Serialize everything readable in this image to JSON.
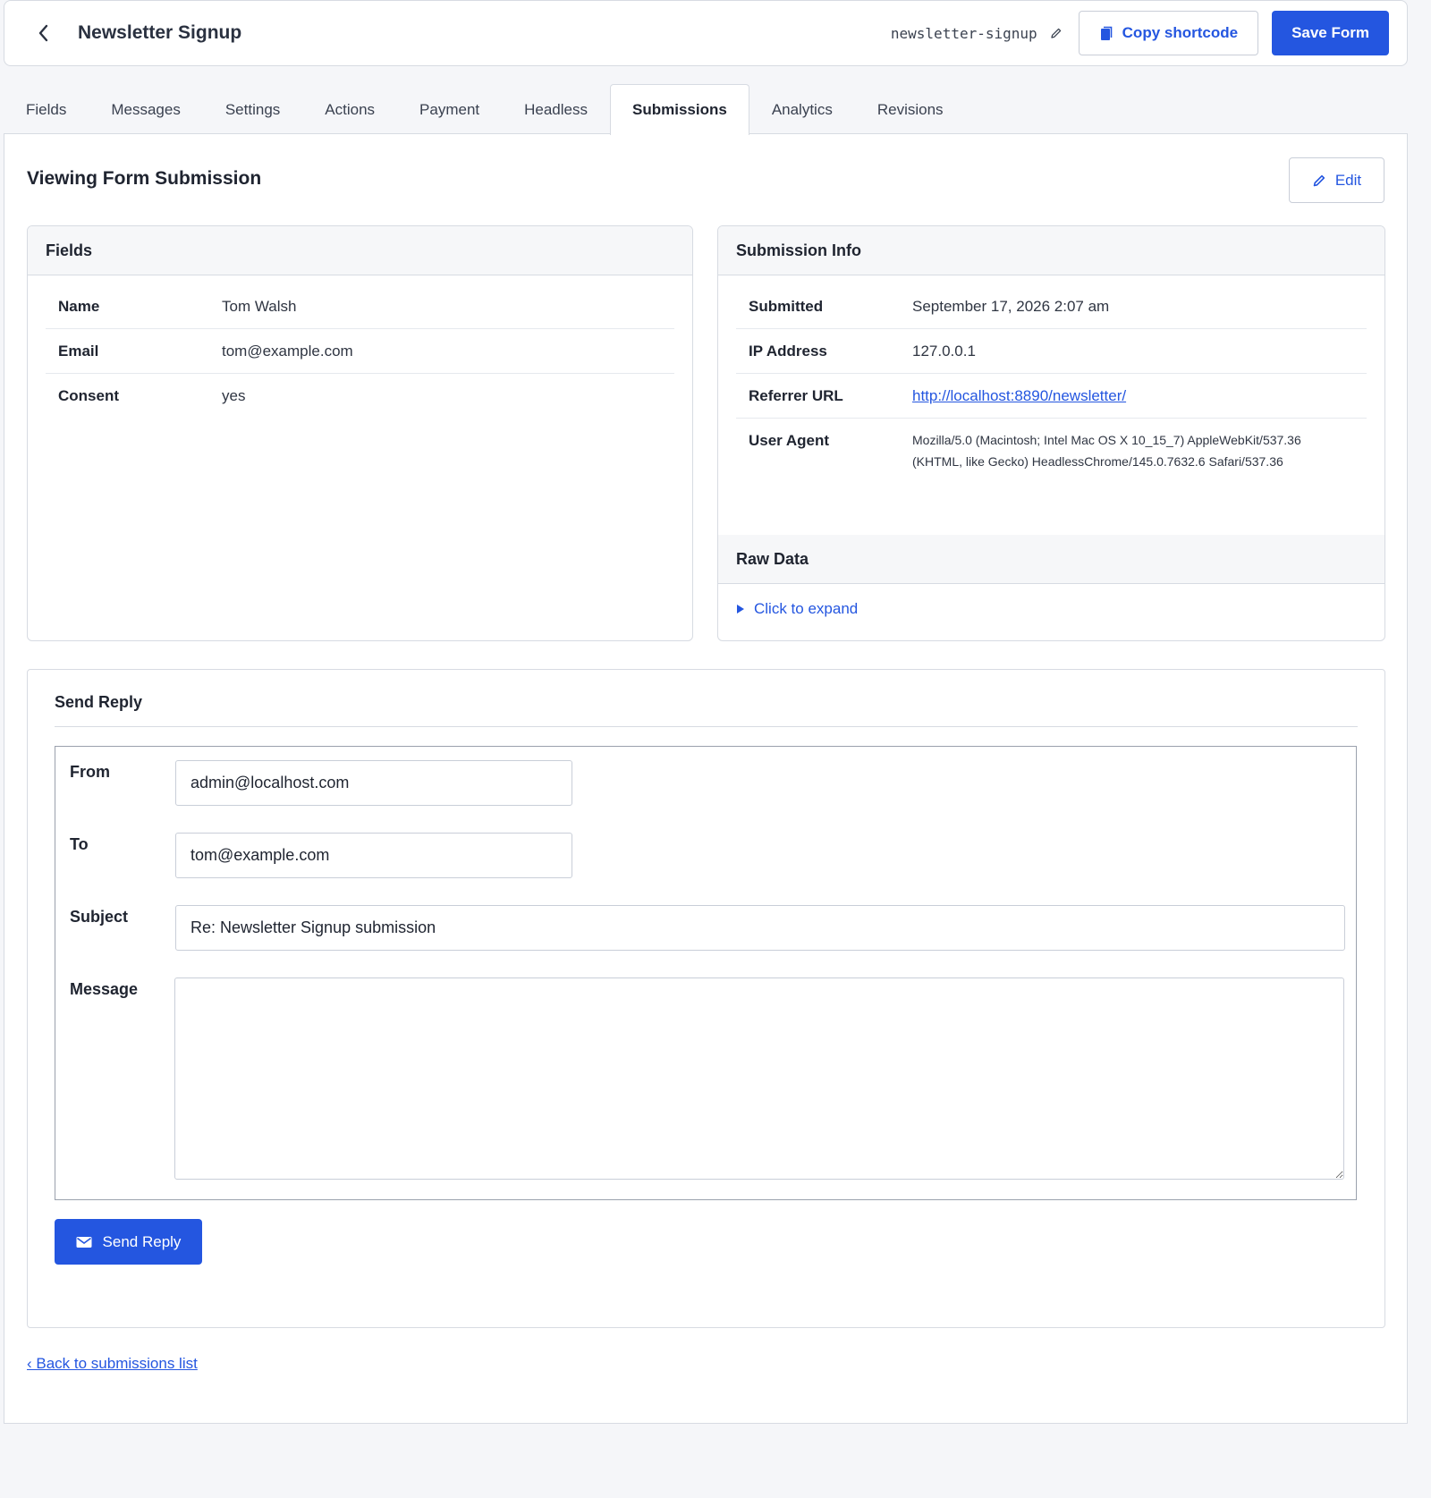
{
  "header": {
    "back_icon": "chevron-left-icon",
    "title": "Newsletter Signup",
    "slug": "newsletter-signup",
    "slug_edit_icon": "pencil-icon",
    "copy_shortcode_label": "Copy shortcode",
    "copy_icon": "clipboard-icon",
    "save_label": "Save Form"
  },
  "tabs": [
    {
      "label": "Fields"
    },
    {
      "label": "Messages"
    },
    {
      "label": "Settings"
    },
    {
      "label": "Actions"
    },
    {
      "label": "Payment"
    },
    {
      "label": "Headless"
    },
    {
      "label": "Submissions",
      "active": true
    },
    {
      "label": "Analytics"
    },
    {
      "label": "Revisions"
    }
  ],
  "page": {
    "title": "Viewing Form Submission",
    "edit_label": "Edit"
  },
  "fields_card": {
    "title": "Fields",
    "rows": [
      {
        "key": "Name",
        "value": "Tom Walsh"
      },
      {
        "key": "Email",
        "value": "tom@example.com"
      },
      {
        "key": "Consent",
        "value": "yes"
      }
    ]
  },
  "info_card": {
    "title": "Submission Info",
    "submitted_label": "Submitted",
    "submitted_value": "September 17, 2026 2:07 am",
    "ip_label": "IP Address",
    "ip_value": "127.0.0.1",
    "referrer_label": "Referrer URL",
    "referrer_value": "http://localhost:8890/newsletter/",
    "ua_label": "User Agent",
    "ua_line1": "Mozilla/5.0 (Macintosh; Intel Mac OS X 10_15_7) AppleWebKit/537.36",
    "ua_line2": "(KHTML, like Gecko) HeadlessChrome/145.0.7632.6 Safari/537.36",
    "raw_title": "Raw Data",
    "expand_label": "Click to expand"
  },
  "reply": {
    "title": "Send Reply",
    "from_label": "From",
    "from_value": "admin@localhost.com",
    "to_label": "To",
    "to_value": "tom@example.com",
    "subject_label": "Subject",
    "subject_value": "Re: Newsletter Signup submission",
    "message_label": "Message",
    "message_value": "",
    "send_label": "Send Reply",
    "send_icon": "envelope-icon"
  },
  "back_link": "‹ Back to submissions list",
  "colors": {
    "accent": "#2456e0",
    "background": "#f5f6f9",
    "border": "#d7dbe2"
  }
}
